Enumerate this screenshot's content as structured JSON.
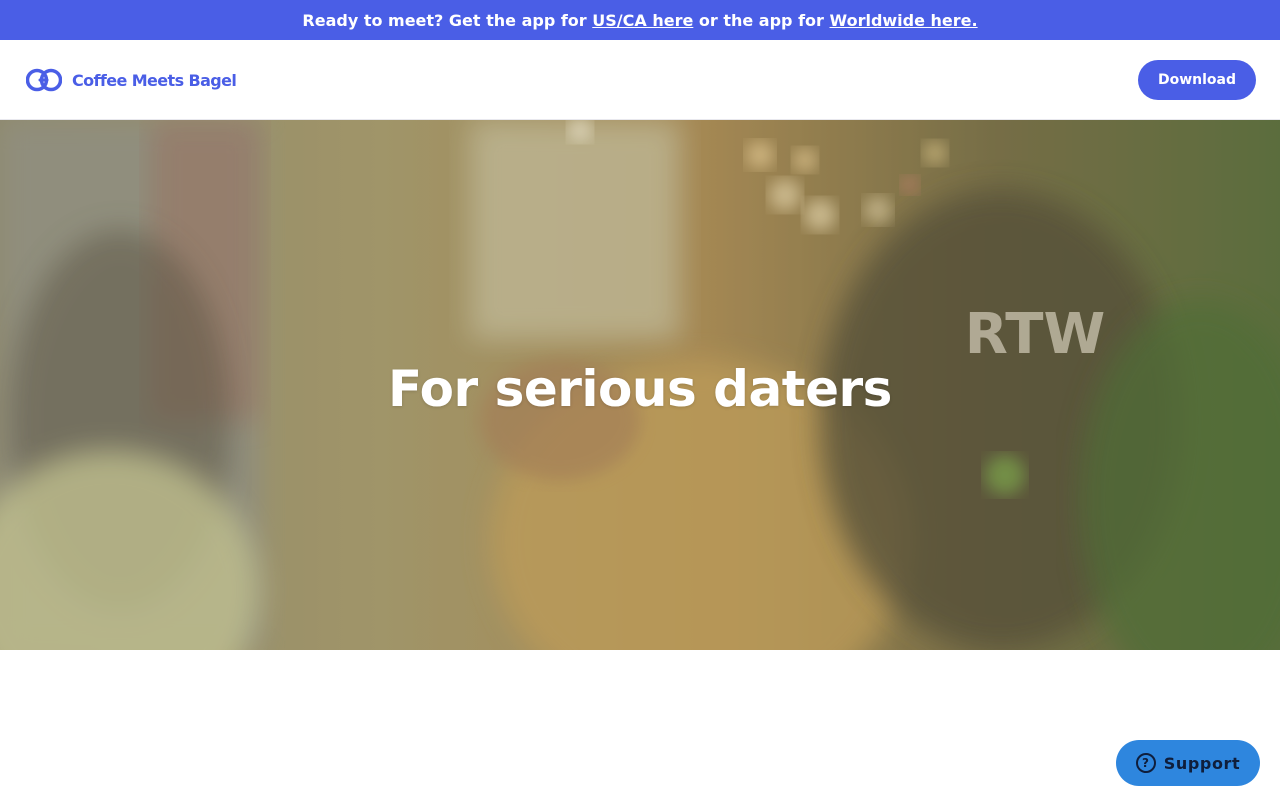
{
  "banner": {
    "prefix": "Ready to meet? Get the app for",
    "link_us": "US/CA here",
    "middle": "or the app for",
    "link_worldwide": "Worldwide here."
  },
  "header": {
    "logo_text": "Coffee Meets Bagel",
    "logo_icon": "cmb-logo-icon",
    "download_label": "Download"
  },
  "hero": {
    "title": "For serious daters",
    "shirt_text": "RTW"
  },
  "support": {
    "label": "Support",
    "icon": "help-circle-icon",
    "icon_glyph": "?"
  },
  "colors": {
    "brand": "#4a5ee6",
    "support": "#2e86de"
  }
}
